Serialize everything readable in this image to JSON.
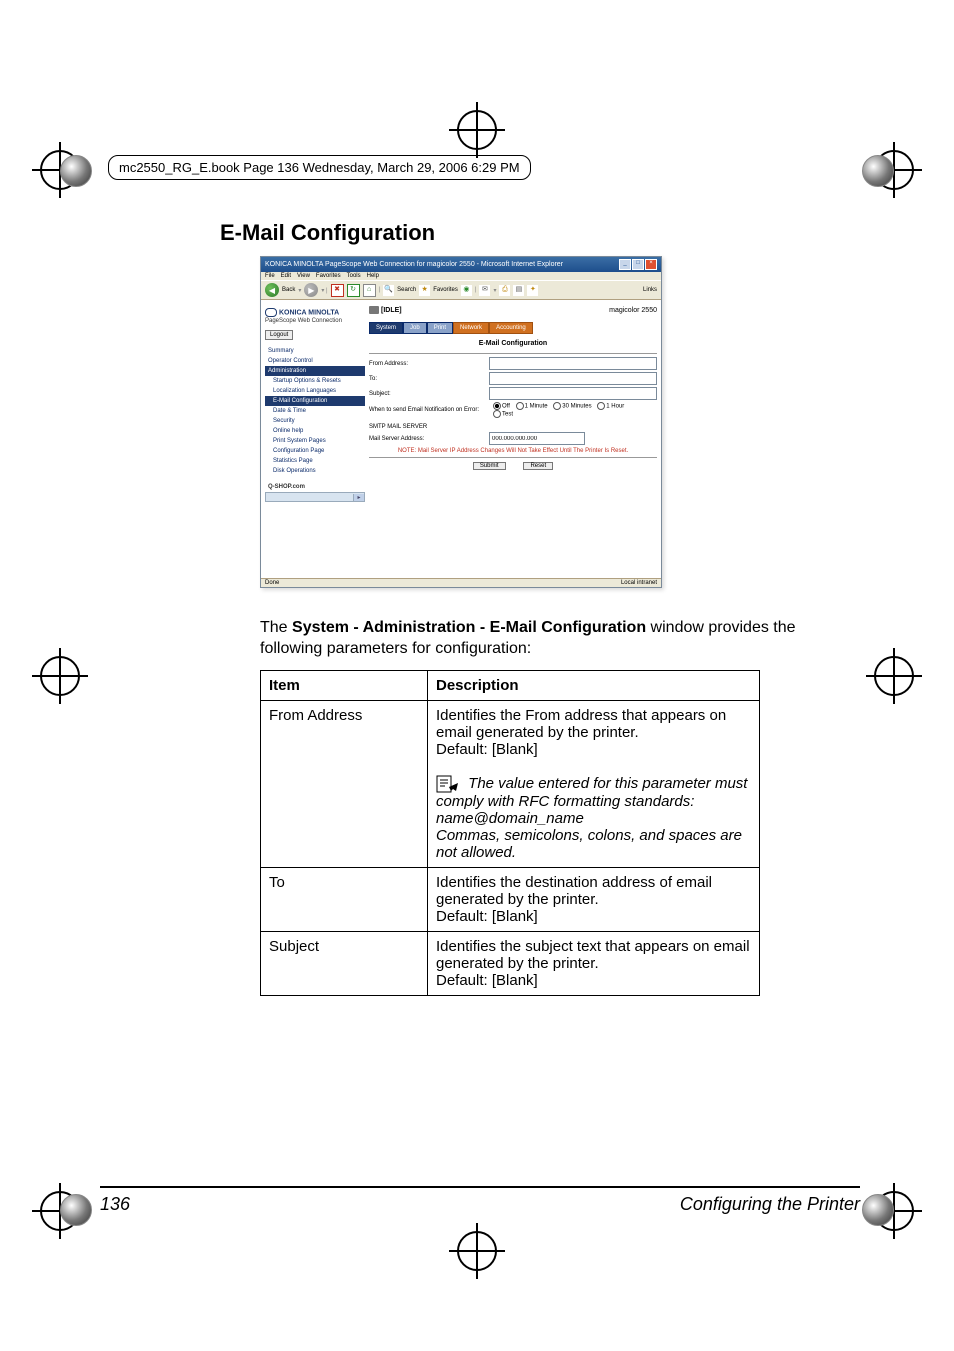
{
  "header_line": "mc2550_RG_E.book  Page 136  Wednesday, March 29, 2006  6:29 PM",
  "section_title": "E-Mail Configuration",
  "browser": {
    "title": "KONICA MINOLTA PageScope Web Connection for magicolor 2550 - Microsoft Internet Explorer",
    "links_label": "Links",
    "menus": [
      "File",
      "Edit",
      "View",
      "Favorites",
      "Tools",
      "Help"
    ],
    "back": "Back",
    "search": "Search",
    "favorites": "Favorites",
    "status_done": "Done",
    "status_zone": "Local intranet"
  },
  "app": {
    "brand": "KONICA MINOLTA",
    "subbrand": "PageScope Web Connection",
    "logout": "Logout",
    "idle": "[IDLE]",
    "model": "magicolor 2550",
    "tabs": {
      "system": "System",
      "job": "Job",
      "print": "Print",
      "network": "Network",
      "accounting": "Accounting"
    },
    "nav": {
      "summary": "Summary",
      "opc": "Operator Control",
      "admin": "Administration",
      "startup": "Startup Options & Resets",
      "loc": "Localization Languages",
      "email": "E-Mail Configuration",
      "date": "Date & Time",
      "sec": "Security",
      "online": "Online help",
      "psp": "Print System Pages",
      "conf": "Configuration Page",
      "stats": "Statistics Page",
      "disk": "Disk Operations",
      "shop": "Q-SHOP.com"
    },
    "pane_title": "E-Mail Configuration",
    "form": {
      "from": "From Address:",
      "to": "To:",
      "subject": "Subject:",
      "when": "When to send Email Notification on Error:",
      "radios": {
        "off": "Off",
        "m1": "1 Minute",
        "m30": "30 Minutes",
        "h1": "1 Hour",
        "test": "Test"
      },
      "smtp": "SMTP MAIL SERVER",
      "mailserver": "Mail Server Address:",
      "ipval": "000.000.000.000",
      "note": "NOTE:  Mail Server IP Address Changes Will Not Take Effect Until The Printer Is Reset.",
      "submit": "Submit",
      "reset": "Reset"
    }
  },
  "body": {
    "intro_pre": "The ",
    "intro_bold": "System - Administration - E-Mail Configuration",
    "intro_post": " window provides the following parameters for configuration:",
    "th_item": "Item",
    "th_desc": "Description",
    "row1_item": "From Address",
    "row1_d1": "Identifies the From address that appears on email generated by the printer.",
    "row1_d2": "Default: [Blank]",
    "row1_note1": "The value entered for this parameter must comply with RFC formatting standards:",
    "row1_note2": "name@domain_name",
    "row1_note3": "Commas, semicolons, colons, and spaces are not allowed.",
    "row2_item": "To",
    "row2_d1": "Identifies the destination address of email generated by the printer.",
    "row2_d2": "Default: [Blank]",
    "row3_item": "Subject",
    "row3_d1": "Identifies the subject text that appears on email generated by the printer.",
    "row3_d2": "Default: [Blank]"
  },
  "footer": {
    "page": "136",
    "chapter": "Configuring the Printer"
  }
}
